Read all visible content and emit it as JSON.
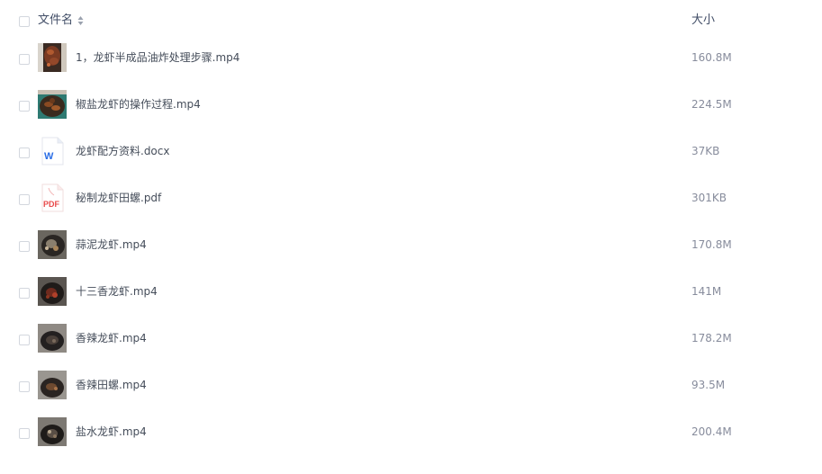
{
  "header": {
    "name_label": "文件名",
    "size_label": "大小",
    "sort_icon": "sort-icon"
  },
  "files": [
    {
      "name": "1，龙虾半成品油炸处理步骤.mp4",
      "size": "160.8M",
      "type": "video"
    },
    {
      "name": "椒盐龙虾的操作过程.mp4",
      "size": "224.5M",
      "type": "video"
    },
    {
      "name": "龙虾配方资料.docx",
      "size": "37KB",
      "type": "word",
      "icon_text": "W"
    },
    {
      "name": "秘制龙虾田螺.pdf",
      "size": "301KB",
      "type": "pdf",
      "icon_text": "PDF"
    },
    {
      "name": "蒜泥龙虾.mp4",
      "size": "170.8M",
      "type": "video"
    },
    {
      "name": "十三香龙虾.mp4",
      "size": "141M",
      "type": "video"
    },
    {
      "name": "香辣龙虾.mp4",
      "size": "178.2M",
      "type": "video"
    },
    {
      "name": "香辣田螺.mp4",
      "size": "93.5M",
      "type": "video"
    },
    {
      "name": "盐水龙虾.mp4",
      "size": "200.4M",
      "type": "video"
    }
  ],
  "colors": {
    "header_text": "#424e67",
    "name_text": "#454d5a",
    "size_text": "#878c9c",
    "checkbox_border": "#d3d7de",
    "word_blue": "#2b6ee6",
    "pdf_red": "#e84a4a"
  }
}
